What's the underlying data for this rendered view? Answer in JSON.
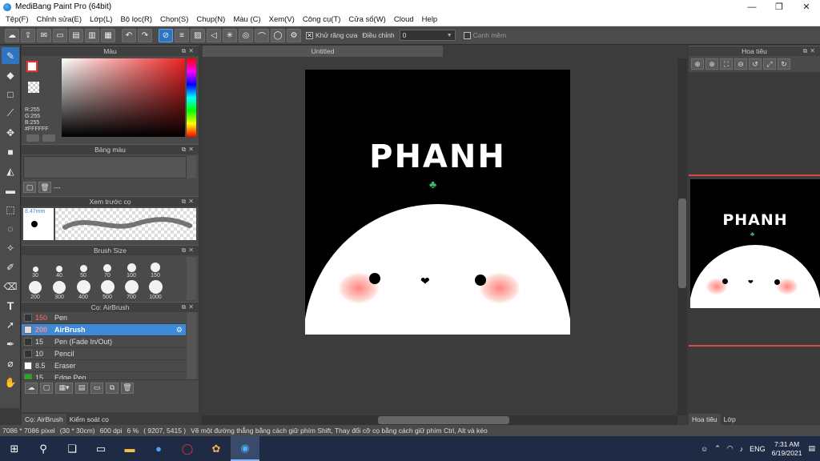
{
  "window": {
    "title": "MediBang Paint Pro (64bit)",
    "minimize": "—",
    "maximize": "❐",
    "close": "✕"
  },
  "menu": [
    "Tệp(F)",
    "Chỉnh sửa(E)",
    "Lớp(L)",
    "Bộ lọc(R)",
    "Chọn(S)",
    "Chụp(N)",
    "Màu (C)",
    "Xem(V)",
    "Công cụ(T)",
    "Cửa sổ(W)",
    "Cloud",
    "Help"
  ],
  "toolbar": {
    "antialias_label": "Khử răng cưa",
    "antialias_checked": true,
    "correction_label": "Điều chỉnh",
    "correction_value": "0",
    "edge_label": "Canh mềm",
    "edge_checked": false
  },
  "color_panel": {
    "title": "Màu",
    "fg_color": "#FFFFFF",
    "rgb_lines": [
      "R:255",
      "G:255",
      "B:255",
      "#FFFFFF"
    ]
  },
  "palette_panel": {
    "title": "Bảng màu",
    "palette_name": "---"
  },
  "preview_panel": {
    "title": "Xem trước cọ",
    "size_label": "8.47mm"
  },
  "brush_size_panel": {
    "title": "Brush Size",
    "sizes": [
      "30",
      "40",
      "50",
      "70",
      "100",
      "150",
      "200",
      "300",
      "400",
      "500",
      "700",
      "1000"
    ]
  },
  "brush_panel": {
    "title": "Cọ: AirBrush",
    "items": [
      {
        "size": "150",
        "name": "Pen",
        "color": "#333333",
        "size_color": "#ff6b6b"
      },
      {
        "size": "200",
        "name": "AirBrush",
        "color": "#dddddd",
        "size_color": "#ff8a8a",
        "selected": true
      },
      {
        "size": "15",
        "name": "Pen (Fade In/Out)",
        "color": "#333333"
      },
      {
        "size": "10",
        "name": "Pencil",
        "color": "#333333"
      },
      {
        "size": "8.5",
        "name": "Eraser",
        "color": "#ffffff"
      },
      {
        "size": "15",
        "name": "Edge Pen",
        "color": "#22aa22"
      }
    ]
  },
  "left_tabs": [
    "Cọ: AirBrush",
    "Kiểm soát cọ"
  ],
  "document": {
    "tab_title": "Untitled",
    "artwork_text": "PHANH"
  },
  "navigator": {
    "title": "Hoa tiêu"
  },
  "right_tabs": [
    "Hoa tiêu",
    "Lớp"
  ],
  "status": {
    "canvas_size": "7086 * 7086 pixel",
    "physical_size": "(30 * 30cm)",
    "dpi": "600 dpi",
    "zoom": "6 %",
    "coords": "( 9207, 5415 )",
    "hint": "Vẽ một đường thẳng bằng cách giữ phím Shift, Thay đổi cỡ cọ bằng cách giữ phím Ctrl, Alt và kéo"
  },
  "taskbar": {
    "lang": "ENG",
    "time": "7:31 AM",
    "date": "6/19/2021"
  }
}
